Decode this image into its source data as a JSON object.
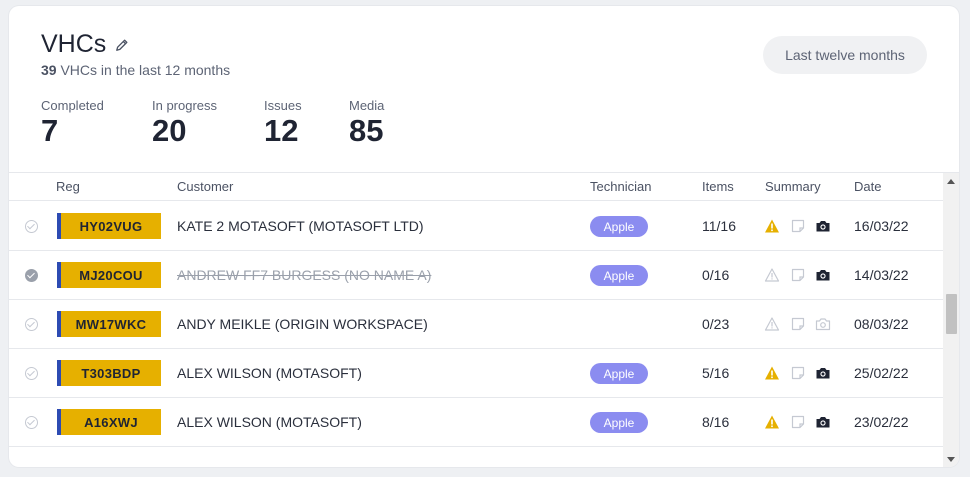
{
  "header": {
    "title": "VHCs",
    "count": "39",
    "subtitle_rest": "VHCs in the last 12 months",
    "range_label": "Last twelve months"
  },
  "stats": [
    {
      "label": "Completed",
      "value": "7"
    },
    {
      "label": "In progress",
      "value": "20"
    },
    {
      "label": "Issues",
      "value": "12"
    },
    {
      "label": "Media",
      "value": "85"
    }
  ],
  "table": {
    "columns": {
      "reg": "Reg",
      "customer": "Customer",
      "technician": "Technician",
      "items": "Items",
      "summary": "Summary",
      "date": "Date"
    },
    "rows": [
      {
        "reg": "HY02VUG",
        "customer": "KATE 2 MOTASOFT (MOTASOFT LTD)",
        "technician": "Apple",
        "items": "11/16",
        "date": "16/03/22",
        "completed": false,
        "cancelled": false,
        "warning": true,
        "note": false,
        "media": true
      },
      {
        "reg": "MJ20COU",
        "customer": "ANDREW FF7 BURGESS (NO NAME A)",
        "technician": "Apple",
        "items": "0/16",
        "date": "14/03/22",
        "completed": true,
        "cancelled": true,
        "warning": false,
        "note": false,
        "media": true
      },
      {
        "reg": "MW17WKC",
        "customer": "ANDY MEIKLE (ORIGIN WORKSPACE)",
        "technician": "",
        "items": "0/23",
        "date": "08/03/22",
        "completed": false,
        "cancelled": false,
        "warning": false,
        "note": false,
        "media": false
      },
      {
        "reg": "T303BDP",
        "customer": "ALEX WILSON (MOTASOFT)",
        "technician": "Apple",
        "items": "5/16",
        "date": "25/02/22",
        "completed": false,
        "cancelled": false,
        "warning": true,
        "note": false,
        "media": true
      },
      {
        "reg": "A16XWJ",
        "customer": "ALEX WILSON (MOTASOFT)",
        "technician": "Apple",
        "items": "8/16",
        "date": "23/02/22",
        "completed": false,
        "cancelled": false,
        "warning": true,
        "note": false,
        "media": true
      }
    ]
  },
  "colors": {
    "plate": "#e6b000",
    "plate_stripe": "#2d4bb3",
    "tech_pill": "#8b8cf0",
    "warning": "#e6b000"
  }
}
